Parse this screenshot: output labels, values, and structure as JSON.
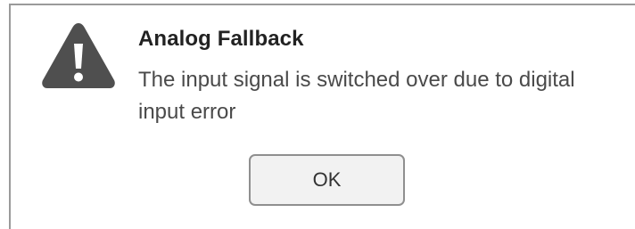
{
  "dialog": {
    "icon": "warning-triangle-icon",
    "title": "Analog Fallback",
    "message": "The input signal is switched over due to digital input error",
    "ok_label": "OK"
  },
  "colors": {
    "icon_fill": "#4f4f4f",
    "icon_symbol": "#ffffff",
    "title_text": "#222222",
    "message_text": "#4a4a4a",
    "button_background": "#f2f2f2",
    "button_border": "#8f8f8f"
  }
}
